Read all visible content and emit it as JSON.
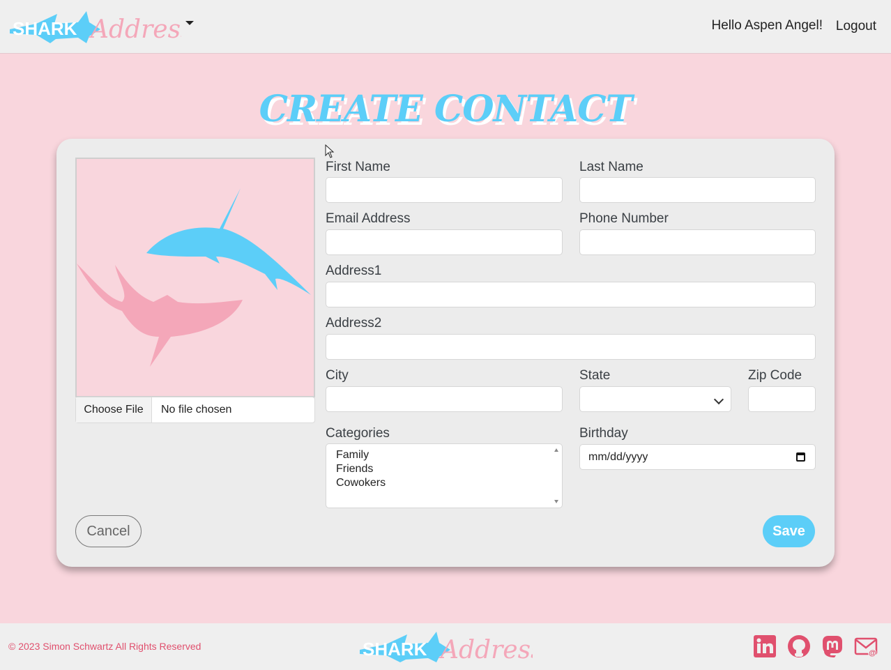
{
  "navbar": {
    "brand_left": "SHARK",
    "brand_right": "Address",
    "greeting": "Hello Aspen Angel!",
    "logout_label": "Logout"
  },
  "page": {
    "title": "CREATE CONTACT"
  },
  "form": {
    "file_button": "Choose File",
    "file_status": "No file chosen",
    "first_name_label": "First Name",
    "last_name_label": "Last Name",
    "email_label": "Email Address",
    "phone_label": "Phone Number",
    "address1_label": "Address1",
    "address2_label": "Address2",
    "city_label": "City",
    "state_label": "State",
    "zip_label": "Zip Code",
    "categories_label": "Categories",
    "categories": [
      "Family",
      "Friends",
      "Cowokers"
    ],
    "birthday_label": "Birthday",
    "birthday_placeholder": "mm/dd/yyyy",
    "cancel_label": "Cancel",
    "save_label": "Save"
  },
  "footer": {
    "copyright": "© 2023 Simon Schwartz All Rights Reserved",
    "brand_left": "SHARK",
    "brand_right": "Address",
    "social": [
      "linkedin-icon",
      "github-icon",
      "mastodon-icon",
      "email-icon"
    ]
  },
  "colors": {
    "accent_blue": "#5ccef8",
    "accent_pink": "#f4a7b9",
    "background_pink": "#f9d6dd",
    "footer_text": "#e0506e",
    "social_icon": "#e0506e"
  }
}
